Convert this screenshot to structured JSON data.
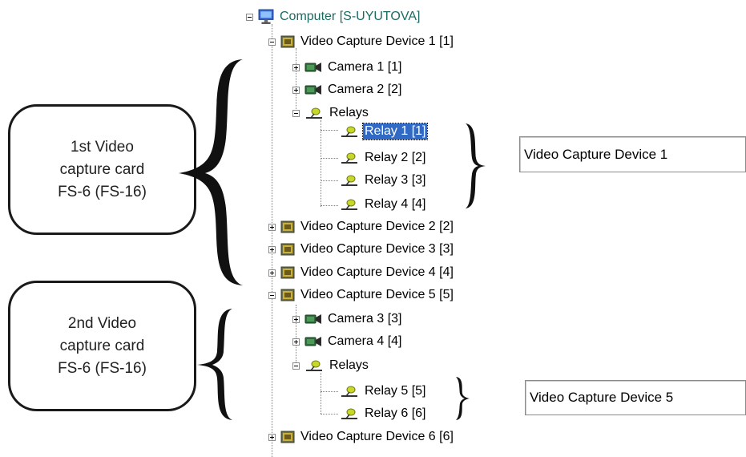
{
  "tree": {
    "root": "Computer [S-UYUTOVA]",
    "device1": "Video Capture Device 1 [1]",
    "camera1": "Camera 1 [1]",
    "camera2": "Camera 2 [2]",
    "relays1": "Relays",
    "relay1": "Relay 1 [1]",
    "relay2": "Relay 2 [2]",
    "relay3": "Relay 3 [3]",
    "relay4": "Relay 4 [4]",
    "device2": "Video Capture Device 2 [2]",
    "device3": "Video Capture Device 3 [3]",
    "device4": "Video Capture Device 4 [4]",
    "device5": "Video Capture Device 5 [5]",
    "camera3": "Camera 3 [3]",
    "camera4": "Camera 4 [4]",
    "relays5": "Relays",
    "relay5": "Relay 5 [5]",
    "relay6": "Relay 6 [6]",
    "device6": "Video Capture Device 6 [6]"
  },
  "callouts": {
    "first": [
      "1st Video",
      "capture card",
      "FS-6 (FS-16)"
    ],
    "second": [
      "2nd Video",
      "capture card",
      "FS-6 (FS-16)"
    ]
  },
  "fields": {
    "first_value": "Video Capture Device 1",
    "second_value": "Video Capture Device 5"
  },
  "colors": {
    "root_text": "#1c6b62",
    "selection": "#316ac5"
  },
  "icons": {
    "computer": "monitor-icon",
    "device": "capture-card-icon",
    "camera": "camera-icon",
    "relay": "relay-icon"
  }
}
